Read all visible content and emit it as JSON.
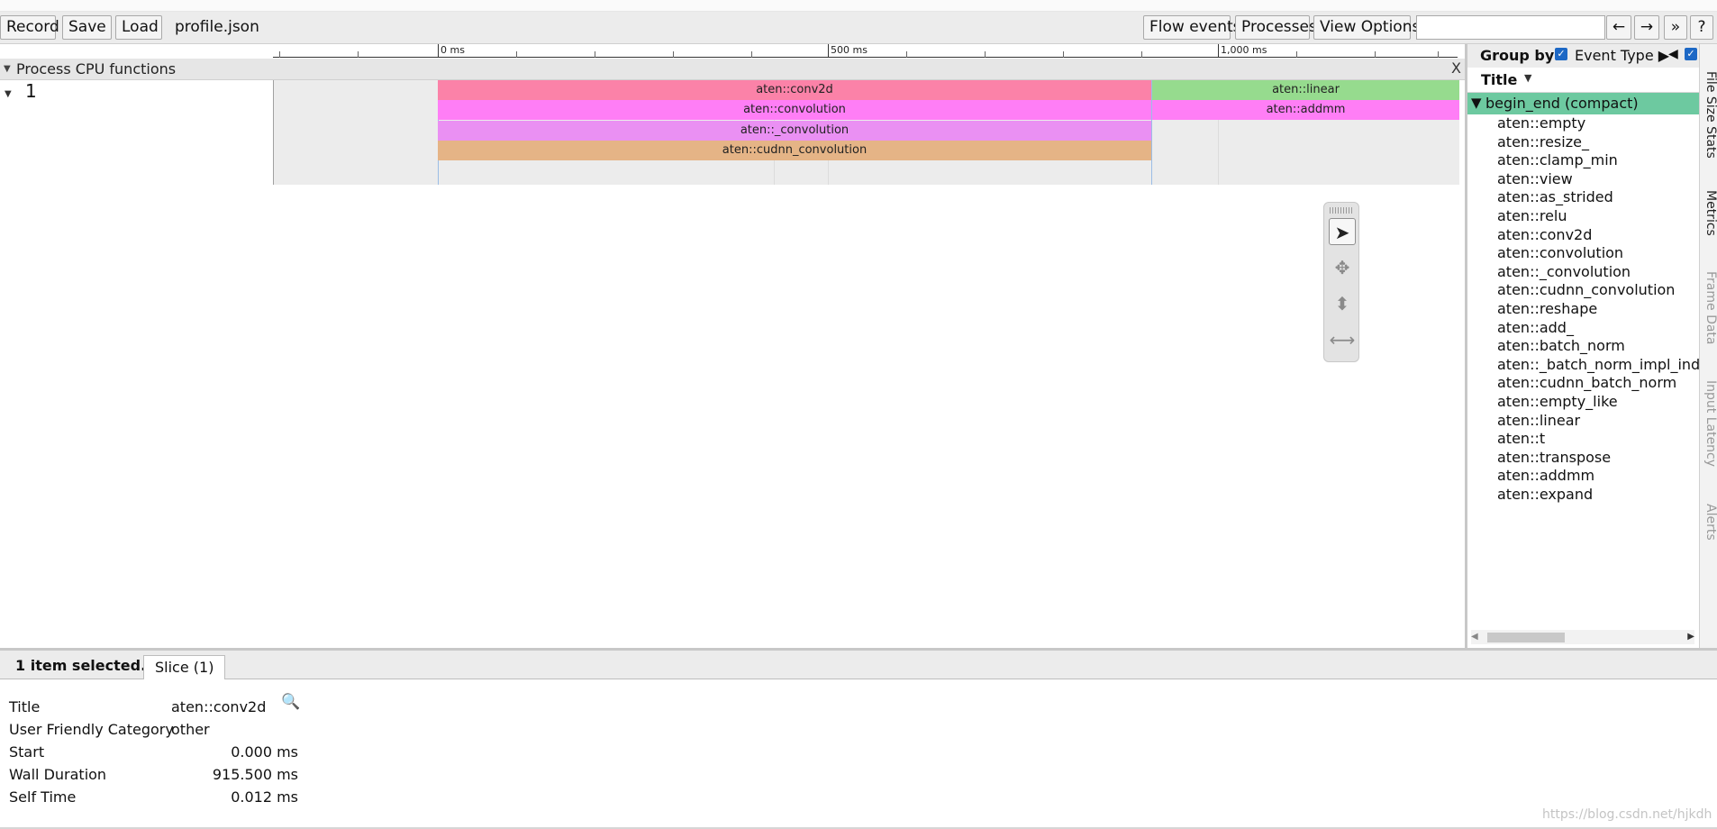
{
  "toolbar": {
    "record": "Record",
    "save": "Save",
    "load": "Load",
    "filename": "profile.json",
    "flow_events": "Flow events",
    "processes": "Processes",
    "view_options": "View Options",
    "search_value": "",
    "nav_prev": "←",
    "nav_next": "→",
    "overflow": "»",
    "help": "?"
  },
  "ruler": {
    "labels": [
      "0 ms",
      "500 ms",
      "1,000 ms"
    ]
  },
  "process": {
    "title": "Process CPU functions",
    "close": "X",
    "thread_name": "1"
  },
  "slices": {
    "conv2d": "aten::conv2d",
    "convolution": "aten::convolution",
    "_convolution": "aten::_convolution",
    "cudnn_convolution": "aten::cudnn_convolution",
    "linear": "aten::linear",
    "addmm": "aten::addmm"
  },
  "colors": {
    "conv2d": "#fb82a8",
    "convolution": "#ff7ef6",
    "_convolution": "#ea90f3",
    "cudnn_convolution": "#e5b486",
    "linear": "#96db8e",
    "addmm": "#ff7ef6",
    "group_header": "#6dc9a0"
  },
  "sidebar": {
    "group_by": "Group by:",
    "event_type": "Event Type ▶",
    "collapse": "◀",
    "title_header": "Title",
    "group_label": "begin_end (compact)",
    "items": [
      "aten::empty",
      "aten::resize_",
      "aten::clamp_min",
      "aten::view",
      "aten::as_strided",
      "aten::relu",
      "aten::conv2d",
      "aten::convolution",
      "aten::_convolution",
      "aten::cudnn_convolution",
      "aten::reshape",
      "aten::add_",
      "aten::batch_norm",
      "aten::_batch_norm_impl_index",
      "aten::cudnn_batch_norm",
      "aten::empty_like",
      "aten::linear",
      "aten::t",
      "aten::transpose",
      "aten::addmm",
      "aten::expand"
    ]
  },
  "side_tabs": [
    "File Size Stats",
    "Metrics",
    "Frame Data",
    "Input Latency",
    "Alerts"
  ],
  "bottom": {
    "selected": "1 item selected.",
    "tab": "Slice (1)",
    "rows": [
      {
        "label": "Title",
        "value": "aten::conv2d"
      },
      {
        "label": "User Friendly Category",
        "value": "other"
      },
      {
        "label": "Start",
        "value": "0.000 ms"
      },
      {
        "label": "Wall Duration",
        "value": "915.500 ms"
      },
      {
        "label": "Self Time",
        "value": "0.012 ms"
      }
    ],
    "watermark": "https://blog.csdn.net/hjkdh"
  }
}
